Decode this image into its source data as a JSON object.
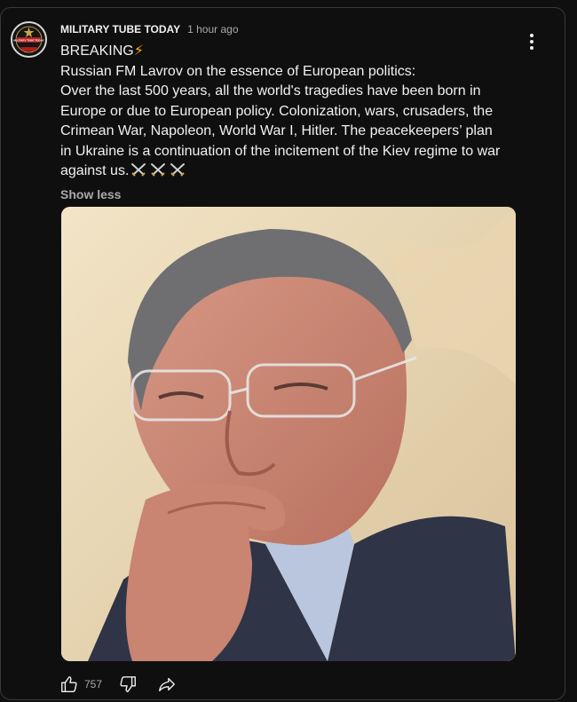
{
  "post": {
    "channel_name": "MILITARY TUBE TODAY",
    "avatar_text": "MILITARY TUBE TODAY",
    "timestamp": "1 hour ago",
    "headline": "BREAKING",
    "headline_emoji": "⚡",
    "lines": [
      "Russian FM Lavrov on the essence of European politics:",
      "Over the last 500 years, all the world's tragedies have been born in Europe or due to European policy. Colonization, wars, crusaders, the Crimean War, Napoleon, World War I, Hitler. The peacekeepers’ plan in Ukraine is a continuation of the incitement of the Kiev regime to war against us."
    ],
    "closing_emoji_icon": "crossed-swords-icon",
    "show_less_label": "Show less",
    "image_alt": "Man with glasses resting chin on hand"
  },
  "actions": {
    "like_count": "757",
    "like_icon": "thumbs-up-icon",
    "dislike_icon": "thumbs-down-icon",
    "share_icon": "share-icon",
    "menu_icon": "more-vert-icon"
  }
}
